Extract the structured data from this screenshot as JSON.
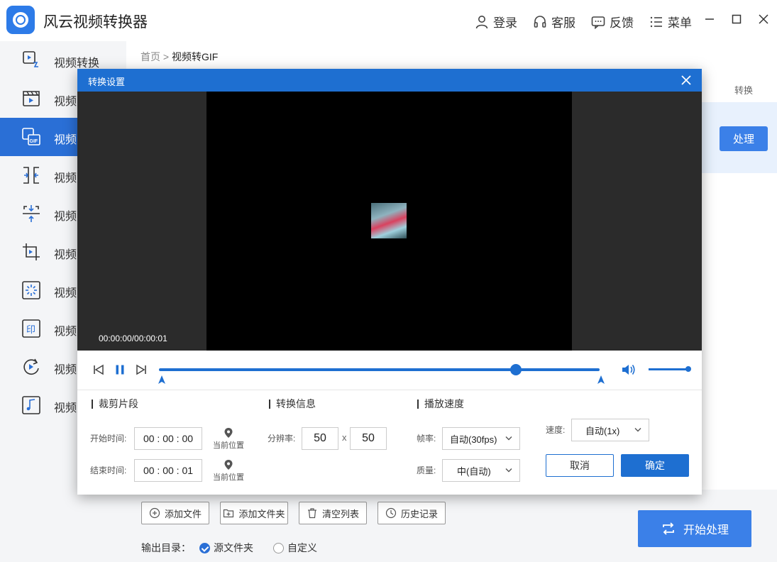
{
  "app": {
    "title": "风云视频转换器"
  },
  "top_actions": {
    "login": "登录",
    "service": "客服",
    "feedback": "反馈",
    "menu": "菜单"
  },
  "sidebar": {
    "items": [
      {
        "label": "视频转换",
        "icon": "video-convert-icon"
      },
      {
        "label": "视频",
        "icon": "clapperboard-icon"
      },
      {
        "label": "视频",
        "icon": "gif-icon",
        "active": true
      },
      {
        "label": "视频",
        "icon": "merge-icon"
      },
      {
        "label": "视频",
        "icon": "compress-icon"
      },
      {
        "label": "视频",
        "icon": "crop-icon"
      },
      {
        "label": "视频",
        "icon": "loading-icon"
      },
      {
        "label": "视频",
        "icon": "stamp-icon"
      },
      {
        "label": "视频",
        "icon": "rotate-play-icon"
      },
      {
        "label": "视频",
        "icon": "music-icon"
      }
    ]
  },
  "breadcrumb": {
    "home": "首页",
    "current": "视频转GIF"
  },
  "table": {
    "col_convert": "转换",
    "process_label": "处理"
  },
  "bottom": {
    "add_file": "添加文件",
    "add_folder": "添加文件夹",
    "clear_list": "清空列表",
    "history": "历史记录",
    "start": "开始处理",
    "output_label": "输出目录：",
    "opt_source": "源文件夹",
    "opt_custom": "自定义"
  },
  "dialog": {
    "title": "转换设置",
    "timecode": "00:00:00/00:00:01",
    "progress_fraction": 0.81,
    "volume_fraction": 1.0,
    "clip": {
      "title": "裁剪片段",
      "start_label": "开始时间:",
      "start_value": "00 : 00 : 00",
      "end_label": "结束时间:",
      "end_value": "00 : 00 : 01",
      "current_pos": "当前位置"
    },
    "info": {
      "title": "转换信息",
      "resolution_label": "分辨率:",
      "width": "50",
      "times": "x",
      "height": "50"
    },
    "speed_section": {
      "title": "播放速度",
      "fps_label": "帧率:",
      "fps_value": "自动(30fps)",
      "quality_label": "质量:",
      "quality_value": "中(自动)",
      "speed_label": "速度:",
      "speed_value": "自动(1x)"
    },
    "cancel": "取消",
    "ok": "确定"
  },
  "colors": {
    "accent": "#1e6fd1",
    "button": "#3b80e8",
    "sidebar_bg": "#f4f5f7"
  }
}
